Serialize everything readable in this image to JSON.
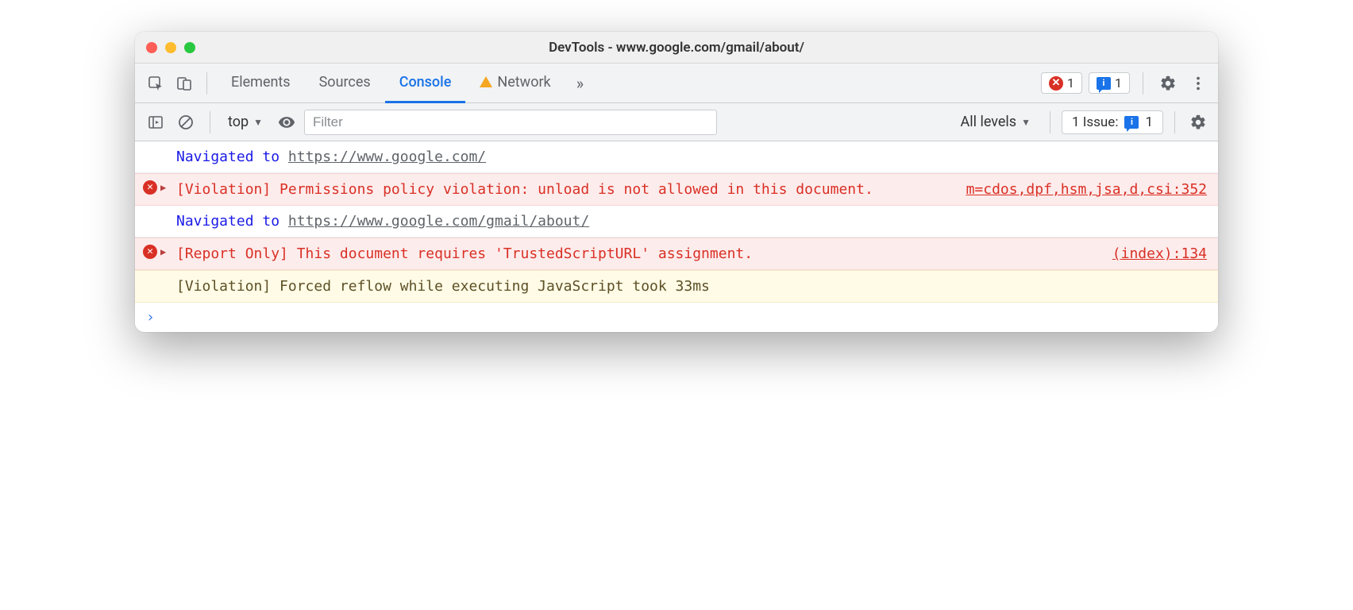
{
  "window": {
    "title": "DevTools - www.google.com/gmail/about/"
  },
  "tabs": {
    "items": [
      "Elements",
      "Sources",
      "Console",
      "Network"
    ],
    "active_index": 2,
    "network_has_warning": true
  },
  "counters": {
    "errors": "1",
    "messages": "1"
  },
  "toolbar": {
    "context": "top",
    "filter_placeholder": "Filter",
    "levels": "All levels",
    "issue_label": "1 Issue:",
    "issue_count": "1"
  },
  "logs": [
    {
      "type": "nav",
      "label": "Navigated to ",
      "url": "https://www.google.com/"
    },
    {
      "type": "error",
      "expandable": true,
      "text": "[Violation] Permissions policy violation: unload is not allowed in this document.",
      "source": "m=cdos,dpf,hsm,jsa,d,csi:352"
    },
    {
      "type": "nav",
      "label": "Navigated to ",
      "url": "https://www.google.com/gmail/about/"
    },
    {
      "type": "error",
      "expandable": true,
      "text": "[Report Only] This document requires 'TrustedScriptURL' assignment.",
      "source": "(index):134"
    },
    {
      "type": "warn",
      "text": "[Violation] Forced reflow while executing JavaScript took 33ms"
    }
  ]
}
